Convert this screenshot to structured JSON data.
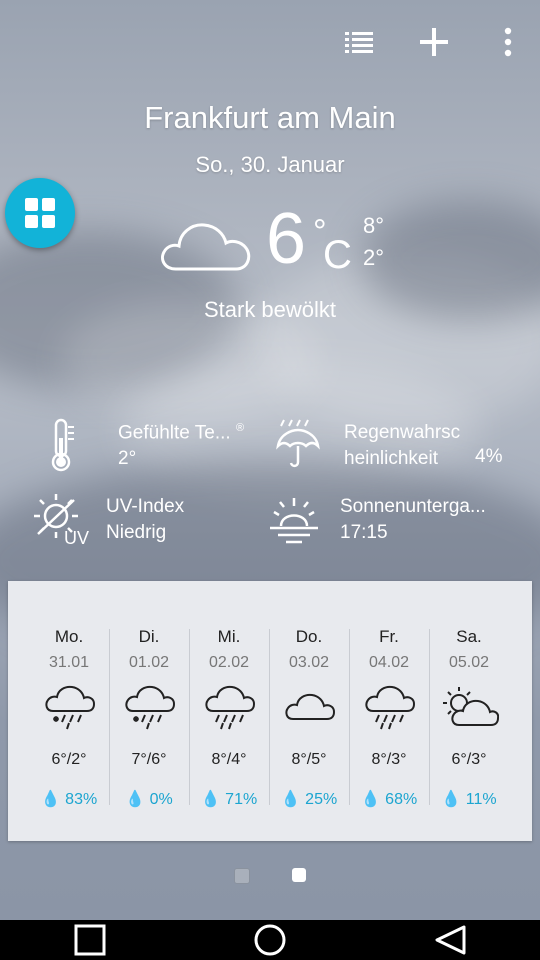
{
  "toolbar": {
    "icons": [
      "list-icon",
      "plus-icon",
      "more-vert-icon"
    ]
  },
  "location": {
    "city": "Frankfurt am Main",
    "date": "So., 30. Januar"
  },
  "current": {
    "temp": "6",
    "deg": "°",
    "unit": "C",
    "high": "8°",
    "low": "2°",
    "condition": "Stark bewölkt"
  },
  "details": {
    "feels": {
      "label": "Gefühlte Te...",
      "mark": "®",
      "value": "2°"
    },
    "rain": {
      "label_line1": "Regenwahrsc",
      "label_line2": "heinlichkeit",
      "value": "4%"
    },
    "uv": {
      "label": "UV-Index",
      "value": "Niedrig",
      "badge": "UV"
    },
    "sunset": {
      "label": "Sonnenunterga...",
      "value": "17:15"
    }
  },
  "forecast": [
    {
      "day": "Mo.",
      "date": "31.01",
      "temp": "6°/2°",
      "rain": "83%",
      "icon": "cloud-snow-rain-icon"
    },
    {
      "day": "Di.",
      "date": "01.02",
      "temp": "7°/6°",
      "rain": "0%",
      "icon": "cloud-snow-rain-icon"
    },
    {
      "day": "Mi.",
      "date": "02.02",
      "temp": "8°/4°",
      "rain": "71%",
      "icon": "cloud-rain-icon"
    },
    {
      "day": "Do.",
      "date": "03.02",
      "temp": "8°/5°",
      "rain": "25%",
      "icon": "cloud-icon"
    },
    {
      "day": "Fr.",
      "date": "04.02",
      "temp": "8°/3°",
      "rain": "68%",
      "icon": "cloud-rain-icon"
    },
    {
      "day": "Sa.",
      "date": "05.02",
      "temp": "6°/3°",
      "rain": "11%",
      "icon": "sun-cloud-icon"
    }
  ],
  "pager": {
    "active_index": 1,
    "count": 2
  },
  "colors": {
    "accent": "#12b3d8",
    "rain": "#1ca5d0",
    "card": "#e8eaee"
  }
}
